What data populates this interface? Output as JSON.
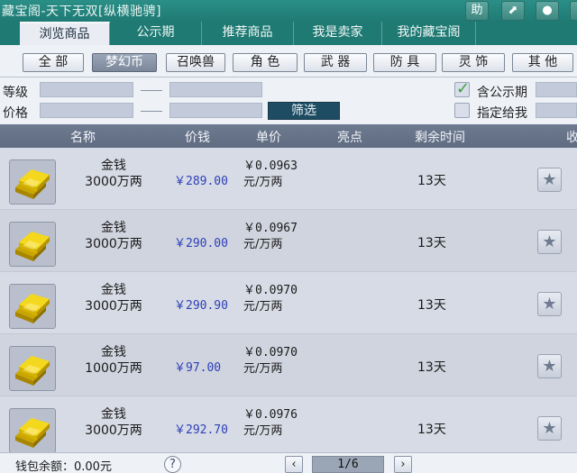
{
  "window": {
    "title": "藏宝阁-天下无双[纵横驰骋]",
    "help_btn": "助",
    "share_btn": "⬈",
    "close_btn": "●"
  },
  "tabs": [
    {
      "label": "浏览商品",
      "active": true
    },
    {
      "label": "公示期",
      "active": false
    },
    {
      "label": "推荐商品",
      "active": false
    },
    {
      "label": "我是卖家",
      "active": false
    },
    {
      "label": "我的藏宝阁",
      "active": false
    }
  ],
  "categories": [
    {
      "label": "全 部",
      "active": false
    },
    {
      "label": "梦幻币",
      "active": true
    },
    {
      "label": "召唤兽",
      "active": false
    },
    {
      "label": "角 色",
      "active": false
    },
    {
      "label": "武 器",
      "active": false
    },
    {
      "label": "防 具",
      "active": false
    },
    {
      "label": "灵 饰",
      "active": false
    },
    {
      "label": "其 他",
      "active": false
    }
  ],
  "filters": {
    "level_label": "等级",
    "price_label": "价格",
    "filter_button": "筛选",
    "include_publicity_label": "含公示期",
    "include_publicity_checked": true,
    "assigned_to_me_label": "指定给我",
    "assigned_to_me_checked": false
  },
  "table": {
    "headers": [
      "名称",
      "价钱",
      "单价",
      "亮点",
      "剩余时间",
      "收"
    ],
    "rows": [
      {
        "name": "金钱",
        "amount": "3000万两",
        "price": "￥289.00",
        "unit_price": "￥0.0963",
        "unit": "元/万两",
        "remaining": "13天",
        "favorite_icon": "star"
      },
      {
        "name": "金钱",
        "amount": "3000万两",
        "price": "￥290.00",
        "unit_price": "￥0.0967",
        "unit": "元/万两",
        "remaining": "13天",
        "favorite_icon": "star"
      },
      {
        "name": "金钱",
        "amount": "3000万两",
        "price": "￥290.90",
        "unit_price": "￥0.0970",
        "unit": "元/万两",
        "remaining": "13天",
        "favorite_icon": "star"
      },
      {
        "name": "金钱",
        "amount": "1000万两",
        "price": "￥97.00",
        "unit_price": "￥0.0970",
        "unit": "元/万两",
        "remaining": "13天",
        "favorite_icon": "star"
      },
      {
        "name": "金钱",
        "amount": "3000万两",
        "price": "￥292.70",
        "unit_price": "￥0.0976",
        "unit": "元/万两",
        "remaining": "13天",
        "favorite_icon": "star"
      }
    ]
  },
  "footer": {
    "wallet_label": "钱包余额：0.00元",
    "help": "?",
    "prev": "‹",
    "next": "›",
    "page": "1/6"
  },
  "colors": {
    "titlebar": "#1f7a74",
    "price_text": "#2c3fb8",
    "header_bg": "#66738a",
    "gold": "#f2d21a"
  }
}
